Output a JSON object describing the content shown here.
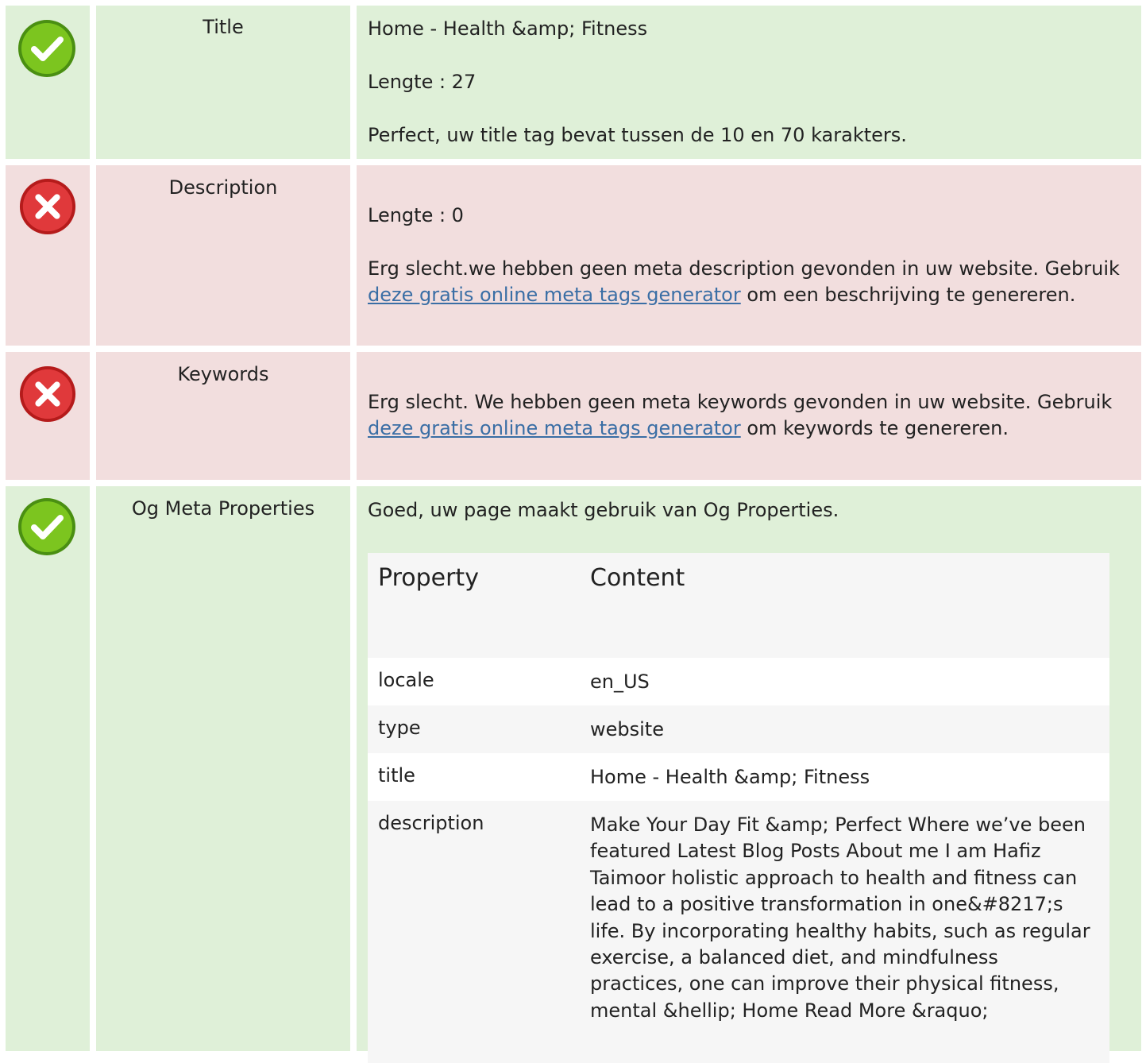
{
  "colors": {
    "good_bg": "#dff0d8",
    "bad_bg": "#f2dede",
    "link": "#3a6ea5"
  },
  "rows": {
    "title": {
      "status": "good",
      "icon": "check-circle-icon",
      "label": "Title",
      "value": "Home - Health &amp; Fitness",
      "length": "Lengte : 27",
      "message": "Perfect, uw title tag bevat tussen de 10 en 70 karakters."
    },
    "description": {
      "status": "bad",
      "icon": "cross-circle-icon",
      "label": "Description",
      "length": "Lengte : 0",
      "message_pre": "Erg slecht.we hebben geen meta description gevonden in uw website. Gebruik ",
      "link_text": "deze gratis online meta tags generator",
      "message_post": " om een beschrijving te genereren."
    },
    "keywords": {
      "status": "bad",
      "icon": "cross-circle-icon",
      "label": "Keywords",
      "message_pre": "Erg slecht. We hebben geen meta keywords gevonden in uw website. Gebruik ",
      "link_text": "deze gratis online meta tags generator",
      "message_post": " om keywords te genereren."
    },
    "og": {
      "status": "good",
      "icon": "check-circle-icon",
      "label": "Og Meta Properties",
      "message": "Goed, uw page maakt gebruik van Og Properties.",
      "table": {
        "headers": [
          "Property",
          "Content"
        ],
        "rows": [
          {
            "property": "locale",
            "content": "en_US"
          },
          {
            "property": "type",
            "content": "website"
          },
          {
            "property": "title",
            "content": "Home - Health &amp; Fitness"
          },
          {
            "property": "description",
            "content": "Make Your Day Fit &amp; Perfect Where we’ve been featured Latest Blog Posts About me I am Hafiz Taimoor holistic approach to health and fitness can lead to a positive transformation in one&#8217;s life. By incorporating healthy habits, such as regular exercise, a balanced diet, and mindfulness practices, one can improve their physical fitness, mental &hellip; Home Read More &raquo;"
          }
        ]
      }
    }
  }
}
